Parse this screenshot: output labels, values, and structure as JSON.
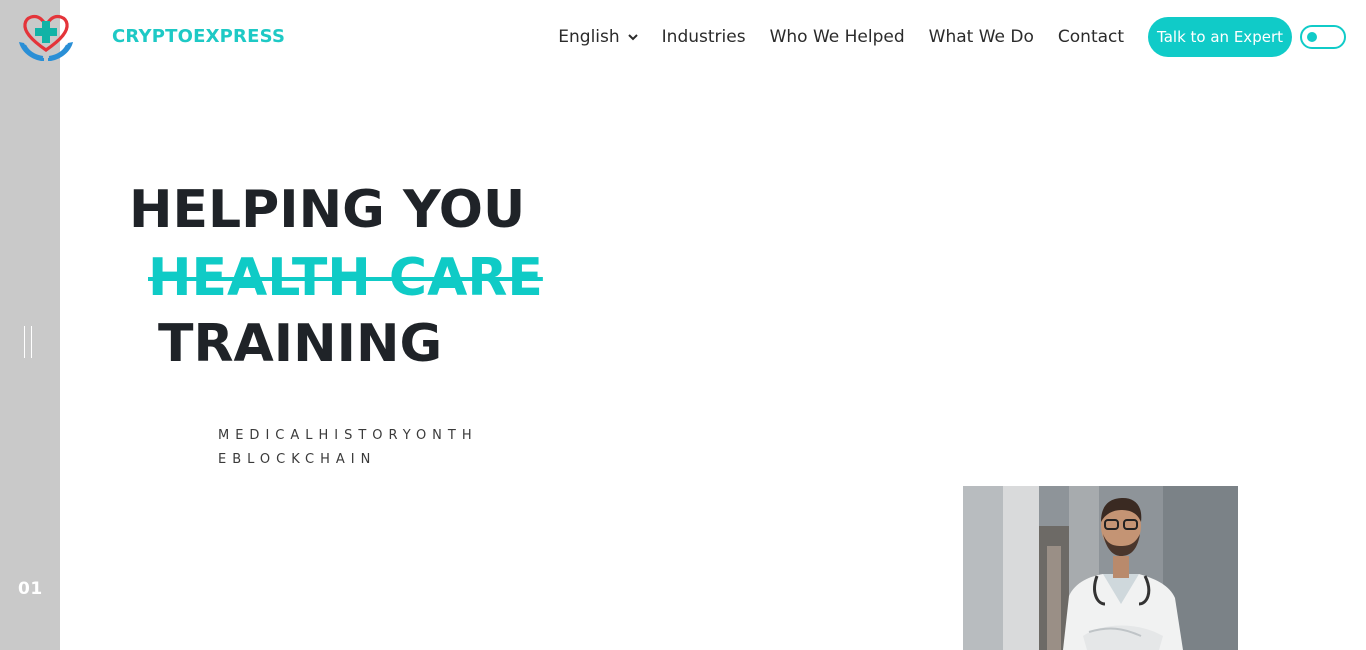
{
  "brand": {
    "name": "CRYPTOEXPRESS",
    "logo_icon": "heart-cross-hands-icon",
    "accent_color": "#10cbc8",
    "heart_color": "#e4343a"
  },
  "nav": {
    "language": "English",
    "items": [
      "Industries",
      "Who We Helped",
      "What We Do",
      "Contact"
    ],
    "cta_label": "Talk to an Expert"
  },
  "hero": {
    "line1": "HELPING YOU",
    "line2": "HEALTH CARE",
    "line3": "TRAINING",
    "tagline": "MEDICALHISTORYONTHEBLOCKCHAIN"
  },
  "rail": {
    "slide_number": "01"
  }
}
